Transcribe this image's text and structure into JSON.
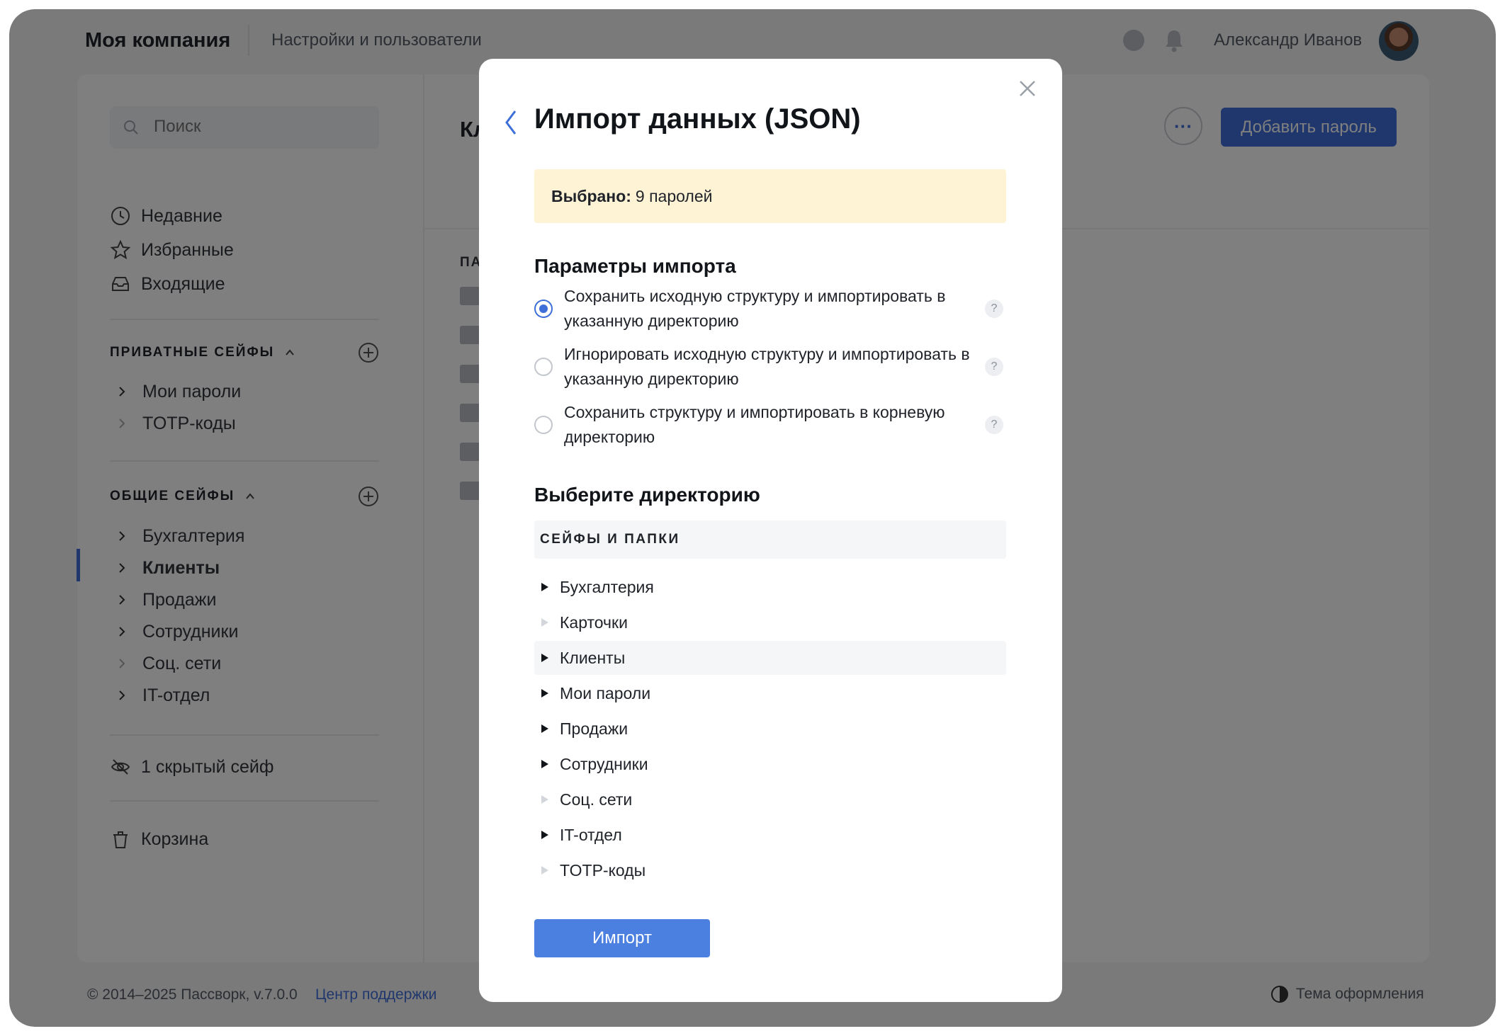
{
  "header": {
    "company": "Моя компания",
    "settings_link": "Настройки и пользователи",
    "username": "Александр Иванов"
  },
  "sidebar": {
    "search_placeholder": "Поиск",
    "quick": [
      {
        "label": "Недавние",
        "icon": "clock-icon"
      },
      {
        "label": "Избранные",
        "icon": "star-icon"
      },
      {
        "label": "Входящие",
        "icon": "inbox-icon"
      }
    ],
    "private_section": {
      "title": "ПРИВАТНЫЕ СЕЙФЫ",
      "items": [
        {
          "label": "Мои пароли",
          "expandable": true
        },
        {
          "label": "TOTP-коды",
          "expandable": false
        }
      ]
    },
    "shared_section": {
      "title": "ОБЩИЕ СЕЙФЫ",
      "items": [
        {
          "label": "Бухгалтерия",
          "expandable": true
        },
        {
          "label": "Клиенты",
          "expandable": true,
          "active": true
        },
        {
          "label": "Продажи",
          "expandable": true
        },
        {
          "label": "Сотрудники",
          "expandable": true
        },
        {
          "label": "Соц. сети",
          "expandable": false
        },
        {
          "label": "IT-отдел",
          "expandable": true
        }
      ]
    },
    "hidden": "1 скрытый сейф",
    "trash": "Корзина"
  },
  "content": {
    "title_partial": "Кл",
    "column_partial": "ПА",
    "add_button": "Добавить пароль",
    "more_button": "···"
  },
  "footer": {
    "copyright": "© 2014–2025 Пассворк, v.7.0.0",
    "support": "Центр поддержки",
    "theme": "Тема оформления"
  },
  "modal": {
    "title": "Импорт данных (JSON)",
    "notice_bold": "Выбрано:",
    "notice_value": "9 паролей",
    "params_title": "Параметры импорта",
    "options": [
      {
        "label": "Сохранить исходную структуру и импортировать в указанную директорию",
        "selected": true
      },
      {
        "label": "Игнорировать исходную структуру и импортировать в указанную директорию",
        "selected": false
      },
      {
        "label": "Сохранить структуру и импортировать в корневую директорию",
        "selected": false
      }
    ],
    "help_glyph": "?",
    "directory_title": "Выберите директорию",
    "table_header": "СЕЙФЫ И ПАПКИ",
    "directories": [
      {
        "label": "Бухгалтерия",
        "expandable": true
      },
      {
        "label": "Карточки",
        "expandable": false
      },
      {
        "label": "Клиенты",
        "expandable": true,
        "selected": true
      },
      {
        "label": "Мои пароли",
        "expandable": true
      },
      {
        "label": "Продажи",
        "expandable": true
      },
      {
        "label": "Сотрудники",
        "expandable": true
      },
      {
        "label": "Соц. сети",
        "expandable": false
      },
      {
        "label": "IT-отдел",
        "expandable": true
      },
      {
        "label": "TOTP-коды",
        "expandable": false
      }
    ],
    "import_button": "Импорт"
  },
  "colors": {
    "accent": "#3e6fd9",
    "notice_bg": "#fff3d6",
    "overlay": "rgba(0,0,0,0.5)"
  }
}
